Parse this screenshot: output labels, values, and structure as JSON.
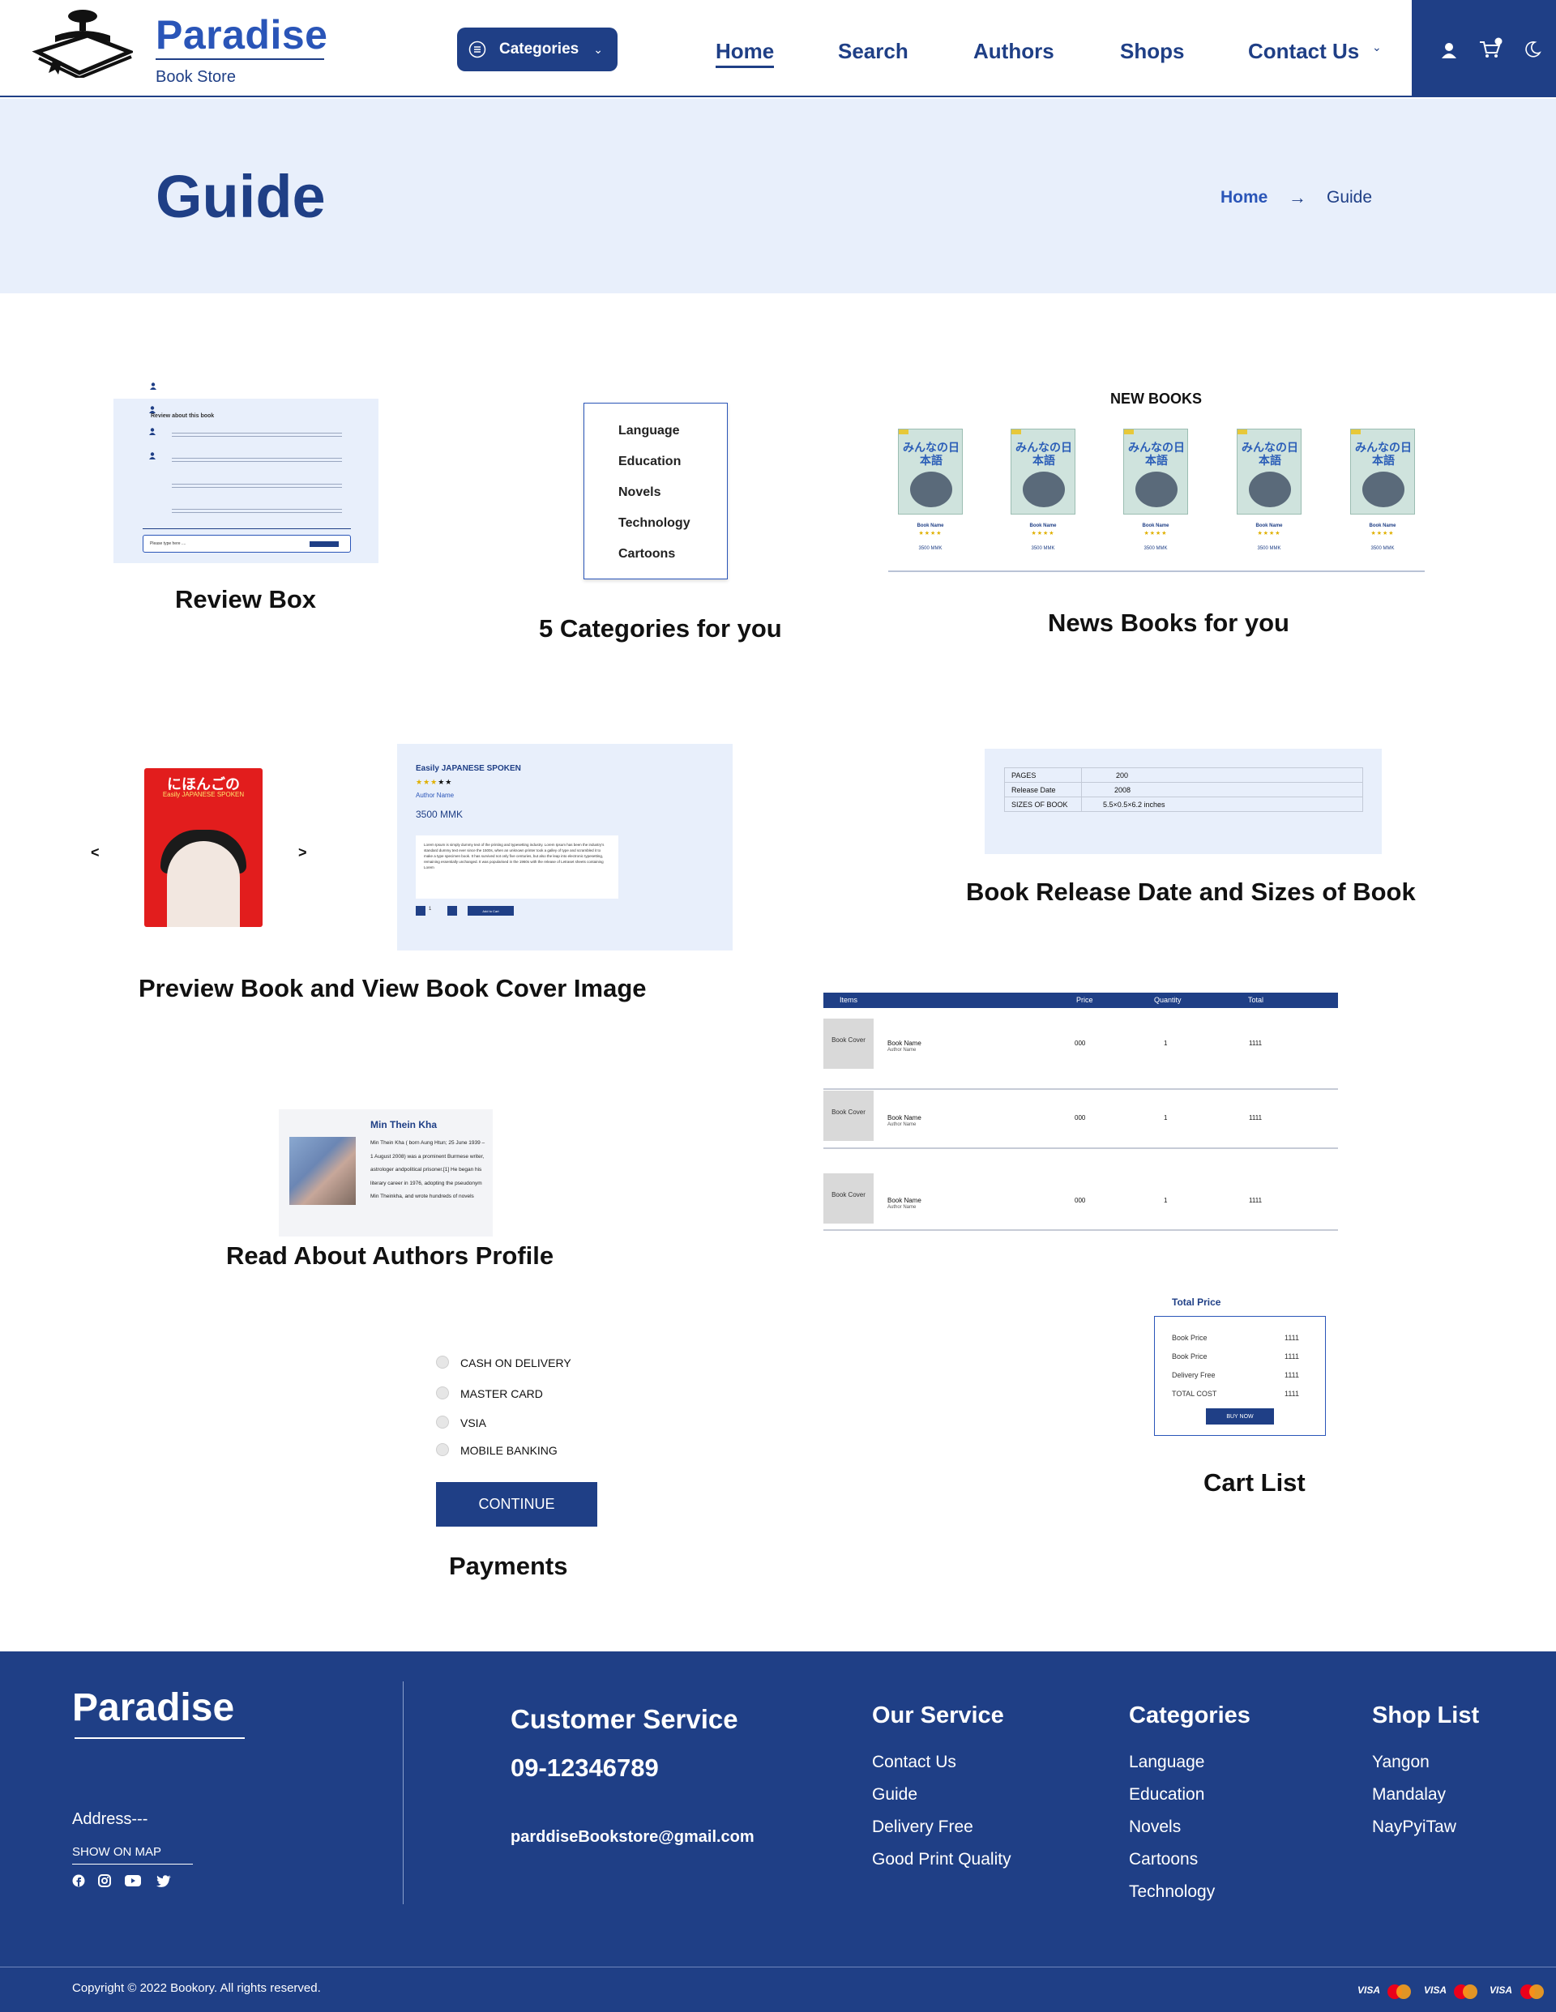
{
  "header": {
    "brand": "Paradise",
    "brand_sub": "Book Store",
    "categories_label": "Categories",
    "nav": [
      "Home",
      "Search",
      "Authors",
      "Shops",
      "Contact Us"
    ]
  },
  "hero": {
    "title": "Guide",
    "breadcrumb_home": "Home",
    "breadcrumb_current": "Guide"
  },
  "review": {
    "caption": "Review Box",
    "heading": "Review about this book",
    "input_placeholder": "Please type here ...."
  },
  "categories": {
    "caption": "5 Categories  for you",
    "items": [
      "Language",
      "Education",
      "Novels",
      "Technology",
      "Cartoons"
    ]
  },
  "new_books": {
    "title": "NEW BOOKS",
    "caption": "News Books for you",
    "books": [
      {
        "name": "Book Name",
        "price": "3500 MMK",
        "cover_text": "みんなの日本語"
      },
      {
        "name": "Book Name",
        "price": "3500 MMK",
        "cover_text": "みんなの日本語"
      },
      {
        "name": "Book Name",
        "price": "3500 MMK",
        "cover_text": "みんなの日本語"
      },
      {
        "name": "Book Name",
        "price": "3500 MMK",
        "cover_text": "みんなの日本語"
      },
      {
        "name": "Book Name",
        "price": "3500 MMK",
        "cover_text": "みんなの日本語"
      }
    ]
  },
  "preview": {
    "caption": "Preview Book and View Book Cover Image",
    "prev": "<",
    "next": ">",
    "cover_title_jp": "にほんごの",
    "cover_sub": "Easily JAPANESE SPOKEN",
    "book_title": "Easily JAPANESE SPOKEN",
    "author": "Author Name",
    "price": "3500 MMK",
    "description": "Lorem Ipsum is simply dummy text of the printing and typesetting industry. Lorem Ipsum has been the industry's standard dummy text ever since the 1500s, when an unknown printer took a galley of type and scrambled it to make a type specimen book. It has survived not only five centuries, but also the leap into electronic typesetting, remaining essentially unchanged. It was popularised in the 1960s with the release of Letraset sheets containing Lorem",
    "quantity": "1",
    "add_to_cart": "Add to Cart"
  },
  "release": {
    "caption": "Book Release Date and Sizes of Book",
    "rows": [
      {
        "label": "PAGES",
        "value": "200"
      },
      {
        "label": "Release Date",
        "value": "2008"
      },
      {
        "label": "SIZES OF BOOK",
        "value": "5.5×0.5×6.2 inches"
      }
    ]
  },
  "cart": {
    "headers": [
      "Items",
      "Price",
      "Quantity",
      "Total"
    ],
    "rows": [
      {
        "cover": "Book Cover",
        "name": "Book Name",
        "author": "Author Name",
        "price": "000",
        "qty": "1",
        "total": "1111"
      },
      {
        "cover": "Book Cover",
        "name": "Book Name",
        "author": "Author Name",
        "price": "000",
        "qty": "1",
        "total": "1111"
      },
      {
        "cover": "Book Cover",
        "name": "Book Name",
        "author": "Author Name",
        "price": "000",
        "qty": "1",
        "total": "1111"
      }
    ]
  },
  "author": {
    "caption": "Read About Authors Profile",
    "name": "Min Thein Kha",
    "bio": "Min Thein Kha ( born Aung Htun; 25 June 1939 – 1 August 2008) was a prominent Burmese writer, astrologer andpolitical prisoner.[1] He began his literary career in 1976, adopting the pseudonym Min Theinkha, and wrote hundreds of novels"
  },
  "payments": {
    "caption": "Payments",
    "options": [
      "CASH ON DELIVERY",
      "MASTER CARD",
      "VSIA",
      "MOBILE BANKING"
    ],
    "continue": "CONTINUE"
  },
  "total": {
    "title": "Total Price",
    "rows": [
      {
        "label": "Book Price",
        "value": "1111"
      },
      {
        "label": "Book Price",
        "value": "1111"
      },
      {
        "label": "Delivery Free",
        "value": "1111"
      },
      {
        "label": "TOTAL COST",
        "value": "1111"
      }
    ],
    "buy": "BUY NOW",
    "caption": "Cart List"
  },
  "footer": {
    "brand": "Paradise",
    "address": "Address---",
    "show_on_map": "SHOW ON MAP",
    "customer_service": "Customer Service",
    "phone": "09-12346789",
    "email": "parddiseBookstore@gmail.com",
    "our_service": {
      "title": "Our Service",
      "items": [
        "Contact Us",
        "Guide",
        "Delivery Free",
        "Good Print Quality"
      ]
    },
    "categories": {
      "title": "Categories",
      "items": [
        "Language",
        "Education",
        "Novels",
        "Cartoons",
        "Technology"
      ]
    },
    "shop_list": {
      "title": "Shop List",
      "items": [
        "Yangon",
        "Mandalay",
        "NayPyiTaw"
      ]
    },
    "copyright": "Copyright © 2022 Bookory. All rights reserved.",
    "payment_logos": [
      "VISA",
      "MasterCard",
      "VISA",
      "MasterCard",
      "VISA",
      "MasterCard"
    ]
  },
  "colors": {
    "primary": "#1f3f86",
    "accent": "#2a55b8",
    "light_bg": "#e8effb"
  }
}
